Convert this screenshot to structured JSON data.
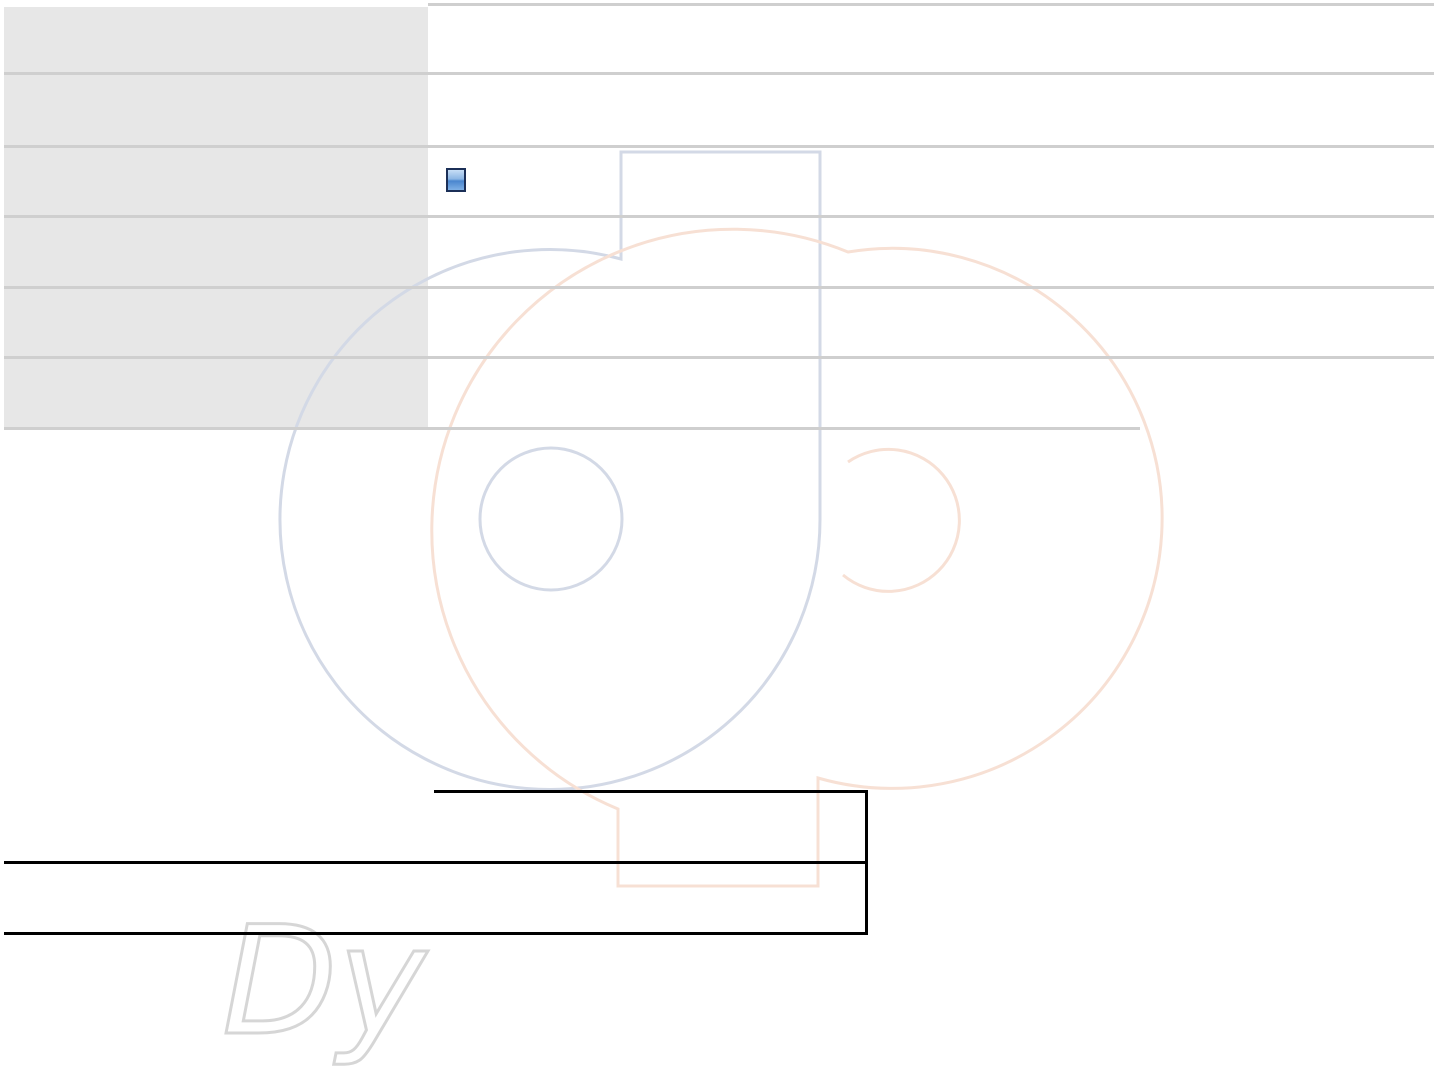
{
  "form_table": {
    "rows": [
      {
        "label": "",
        "value": ""
      },
      {
        "label": "",
        "value": ""
      },
      {
        "label": "",
        "value": "",
        "checkbox": {
          "checked": false,
          "label": ""
        }
      },
      {
        "label": "",
        "value": ""
      },
      {
        "label": "",
        "value": ""
      },
      {
        "label": "",
        "value": ""
      }
    ]
  },
  "bottom_box": {
    "rows": [
      {
        "value": ""
      },
      {
        "value": ""
      }
    ]
  },
  "watermark": {
    "logo": "dp-disc-logo",
    "text": "Dy",
    "colors": {
      "disc_left": "#d3d9e6",
      "disc_right": "#f7e0d4",
      "text_outline": "#d6d6d6"
    }
  },
  "colors": {
    "label_background": "#e7e7e7",
    "row_divider": "#cfcfcf",
    "bottom_box_border": "#000000",
    "checkbox_border": "#1b2f57",
    "checkbox_fill": "#4a86cf"
  }
}
